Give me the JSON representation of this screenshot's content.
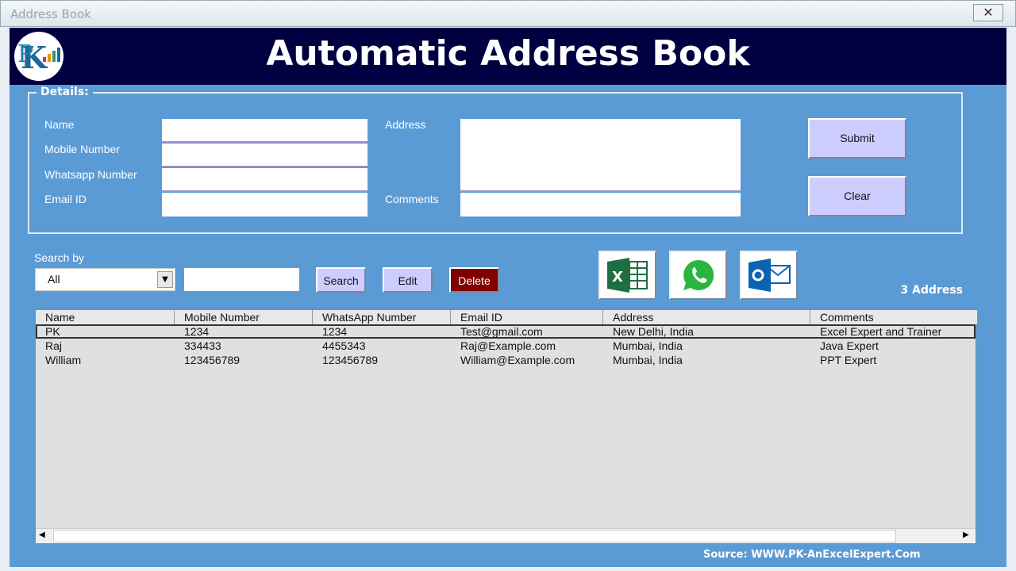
{
  "window": {
    "title": "Address Book",
    "close": "✕"
  },
  "header": {
    "title": "Automatic Address Book",
    "logo": "PK An Excel Expert"
  },
  "details": {
    "legend": "Details:",
    "name_label": "Name",
    "mobile_label": "Mobile Number",
    "whatsapp_label": "Whatsapp Number",
    "email_label": "Email ID",
    "address_label": "Address",
    "comments_label": "Comments",
    "name": "",
    "mobile": "",
    "whatsapp": "",
    "email": "",
    "address": "",
    "comments": "",
    "submit": "Submit",
    "clear": "Clear"
  },
  "search": {
    "label": "Search by",
    "selected": "All",
    "value": "",
    "search": "Search",
    "edit": "Edit",
    "delete": "Delete"
  },
  "icons": [
    "excel-icon",
    "whatsapp-icon",
    "outlook-icon"
  ],
  "count": "3 Address",
  "table": {
    "columns": [
      "Name",
      "Mobile Number",
      "WhatsApp Number",
      "Email ID",
      "Address",
      "Comments"
    ],
    "rows": [
      [
        "PK",
        "1234",
        "1234",
        "Test@gmail.com",
        "New Delhi, India",
        "Excel Expert and Trainer"
      ],
      [
        "Raj",
        "334433",
        "4455343",
        "Raj@Example.com",
        "Mumbai, India",
        "Java Expert"
      ],
      [
        "William",
        "123456789",
        "123456789",
        "William@Example.com",
        "Mumbai, India",
        "PPT Expert"
      ]
    ]
  },
  "footer": "Source: WWW.PK-AnExcelExpert.Com",
  "colors": {
    "form": "#5b9bd5",
    "header": "#000040",
    "button": "#ccccff",
    "delete": "#800000"
  }
}
